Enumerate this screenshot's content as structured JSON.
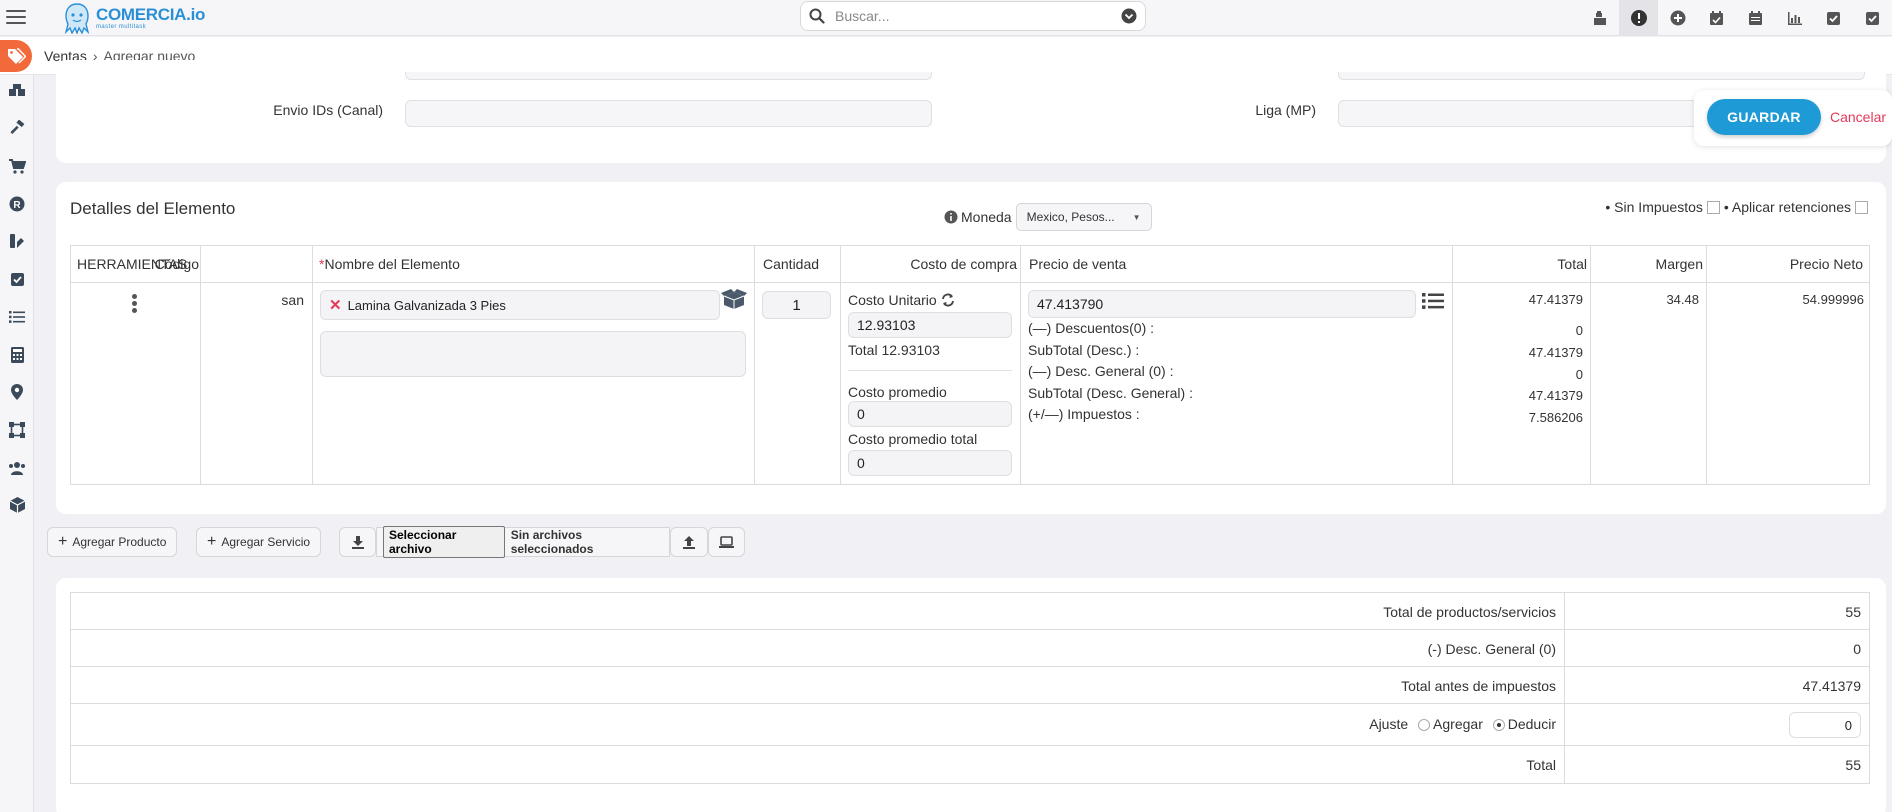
{
  "app": {
    "logo_name": "COMERCIA.io",
    "logo_tagline": "master multitask",
    "search_placeholder": "Buscar..."
  },
  "top_icons": [
    "cash-register-icon",
    "alert-icon",
    "plus-circle-icon",
    "calendar-check-icon",
    "calendar-icon",
    "bar-chart-icon",
    "checkbox-icon",
    "check-square-icon"
  ],
  "breadcrumb": {
    "section": "Ventas",
    "separator": "›",
    "current": "Agregar nuevo"
  },
  "sidebar_icons": [
    "boxes-icon",
    "hammer-icon",
    "cart-icon",
    "registered-icon",
    "tools-icon",
    "checkbox-icon",
    "list-icon",
    "calculator-icon",
    "map-pin-icon",
    "vector-icon",
    "users-icon",
    "box-icon"
  ],
  "form": {
    "envio_label": "Envio IDs (Canal)",
    "envio_value": "",
    "liga_label": "Liga (MP)",
    "liga_value": ""
  },
  "actions": {
    "save": "GUARDAR",
    "cancel": "Cancelar"
  },
  "details": {
    "title": "Detalles del Elemento",
    "currency_label": "Moneda",
    "currency_value": "Mexico, Pesos...",
    "sin_impuestos": "• Sin Impuestos",
    "retenciones": "• Aplicar retenciones"
  },
  "items_table": {
    "headers": {
      "tools": "HERRAMIENTAS",
      "code": "Código",
      "name_required_mark": "*",
      "name": "Nombre del Elemento",
      "qty": "Cantidad",
      "cost": "Costo de compra",
      "price": "Precio de venta",
      "total": "Total",
      "margin": "Margen",
      "net_price": "Precio Neto"
    },
    "row": {
      "code": "san",
      "name": "Lamina Galvanizada 3 Pies",
      "description": "",
      "qty": "1",
      "cost_unit_label": "Costo Unitario",
      "cost_unit": "12.93103",
      "cost_total": "Total 12.93103",
      "avg_cost_label": "Costo promedio",
      "avg_cost": "0",
      "avg_cost_total_label": "Costo promedio total",
      "avg_cost_total": "0",
      "price": "47.413790",
      "discounts_label": "Descuentos(0) :",
      "subtotal_desc_label": "SubTotal (Desc.) :",
      "general_desc_label": "Desc. General (0) :",
      "subtotal_general_label": "SubTotal (Desc. General) :",
      "taxes_label": "Impuestos :",
      "total_values": [
        "47.41379",
        "0",
        "47.41379",
        "0",
        "47.41379",
        "7.586206"
      ],
      "margin": "34.48",
      "net_price": "54.999996"
    }
  },
  "buttons": {
    "add_product": "Agregar Producto",
    "add_service": "Agregar Servicio",
    "choose_file": "Seleccionar archivo",
    "no_files": "Sin archivos seleccionados"
  },
  "totals": {
    "products_label": "Total de productos/servicios",
    "products_value": "55",
    "general_desc_label": "(-) Desc. General (0)",
    "general_desc_value": "0",
    "before_tax_label": "Total antes de impuestos",
    "before_tax_value": "47.41379",
    "adjust_label": "Ajuste",
    "adjust_add": "Agregar",
    "adjust_deduct": "Deducir",
    "adjust_value": "0",
    "total_label": "Total",
    "total_value": "55"
  },
  "colors": {
    "brand_blue": "#2b8fd6",
    "save_blue": "#1e9ad6",
    "cancel_red": "#e5395a",
    "breadcrumb_orange": "#f26a3c",
    "required_red": "#e5395a"
  }
}
